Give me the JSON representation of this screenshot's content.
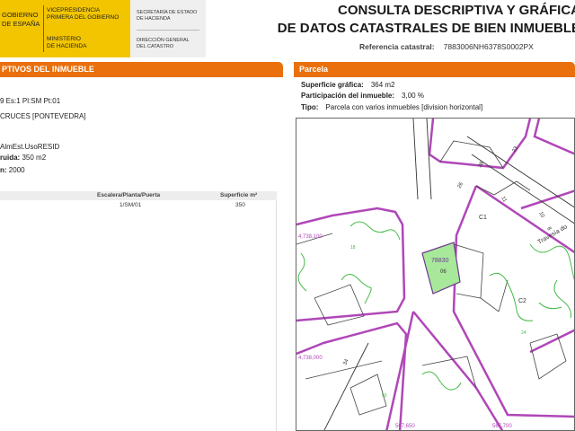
{
  "header": {
    "gov_lines": [
      "GOBIERNO",
      "DE ESPAÑA"
    ],
    "vice_lines": [
      "VICEPRESIDENCIA",
      "PRIMERA DEL GOBIERNO"
    ],
    "ministry_lines": [
      "MINISTERIO",
      "DE HACIENDA"
    ],
    "secretaria_lines": [
      "SECRETARÍA DE ESTADO",
      "DE HACIENDA"
    ],
    "direccion_lines": [
      "DIRECCIÓN GENERAL",
      "DEL CATASTRO"
    ],
    "title_line1": "CONSULTA DESCRIPTIVA Y GRÁFICA",
    "title_line2": "DE DATOS CATASTRALES DE BIEN INMUEBLE",
    "ref_label": "Referencia catastral:",
    "ref_value": "7883006NH6378S0002PX"
  },
  "left_section": {
    "bar_title": "PTIVOS DEL INMUEBLE",
    "line1": "9 Es:1 Pl:SM Pt:01",
    "line2": "CRUCES [PONTEVEDRA]",
    "line3": "AlmEst.UsoRESID",
    "line4_label": "ruida:",
    "line4_value": "350 m2",
    "line5_label": "n:",
    "line5_value": "2000"
  },
  "units_table": {
    "headers": [
      "Escalera/Planta/Puerta",
      "Superficie m²"
    ],
    "rows": [
      [
        "1/SM/01",
        "350"
      ]
    ]
  },
  "parcela": {
    "bar_title": "Parcela",
    "superficie_label": "Superficie gráfica:",
    "superficie_value": "364 m2",
    "participacion_label": "Participación del inmueble:",
    "participacion_value": "3,00 %",
    "tipo_label": "Tipo:",
    "tipo_value": "Parcela con varios inmuebles [division horizontal]"
  },
  "map": {
    "coord_y1": "4,738,100",
    "coord_y2": "4,738,000",
    "coord_x1": "567,650",
    "coord_x2": "567,700",
    "parcel_id": "78830",
    "parcel_num": "06",
    "label_c1": "C1",
    "label_c2": "C2",
    "street_label": "Travesía do",
    "numbers": [
      "38",
      "26",
      "23",
      "10",
      "11",
      "8",
      "18",
      "34",
      "24",
      "50"
    ],
    "colors": {
      "boundary": "#b047b8",
      "vegetation": "#44bb44",
      "parcel_fill": "#a8e89a",
      "street_line": "#333333"
    }
  }
}
